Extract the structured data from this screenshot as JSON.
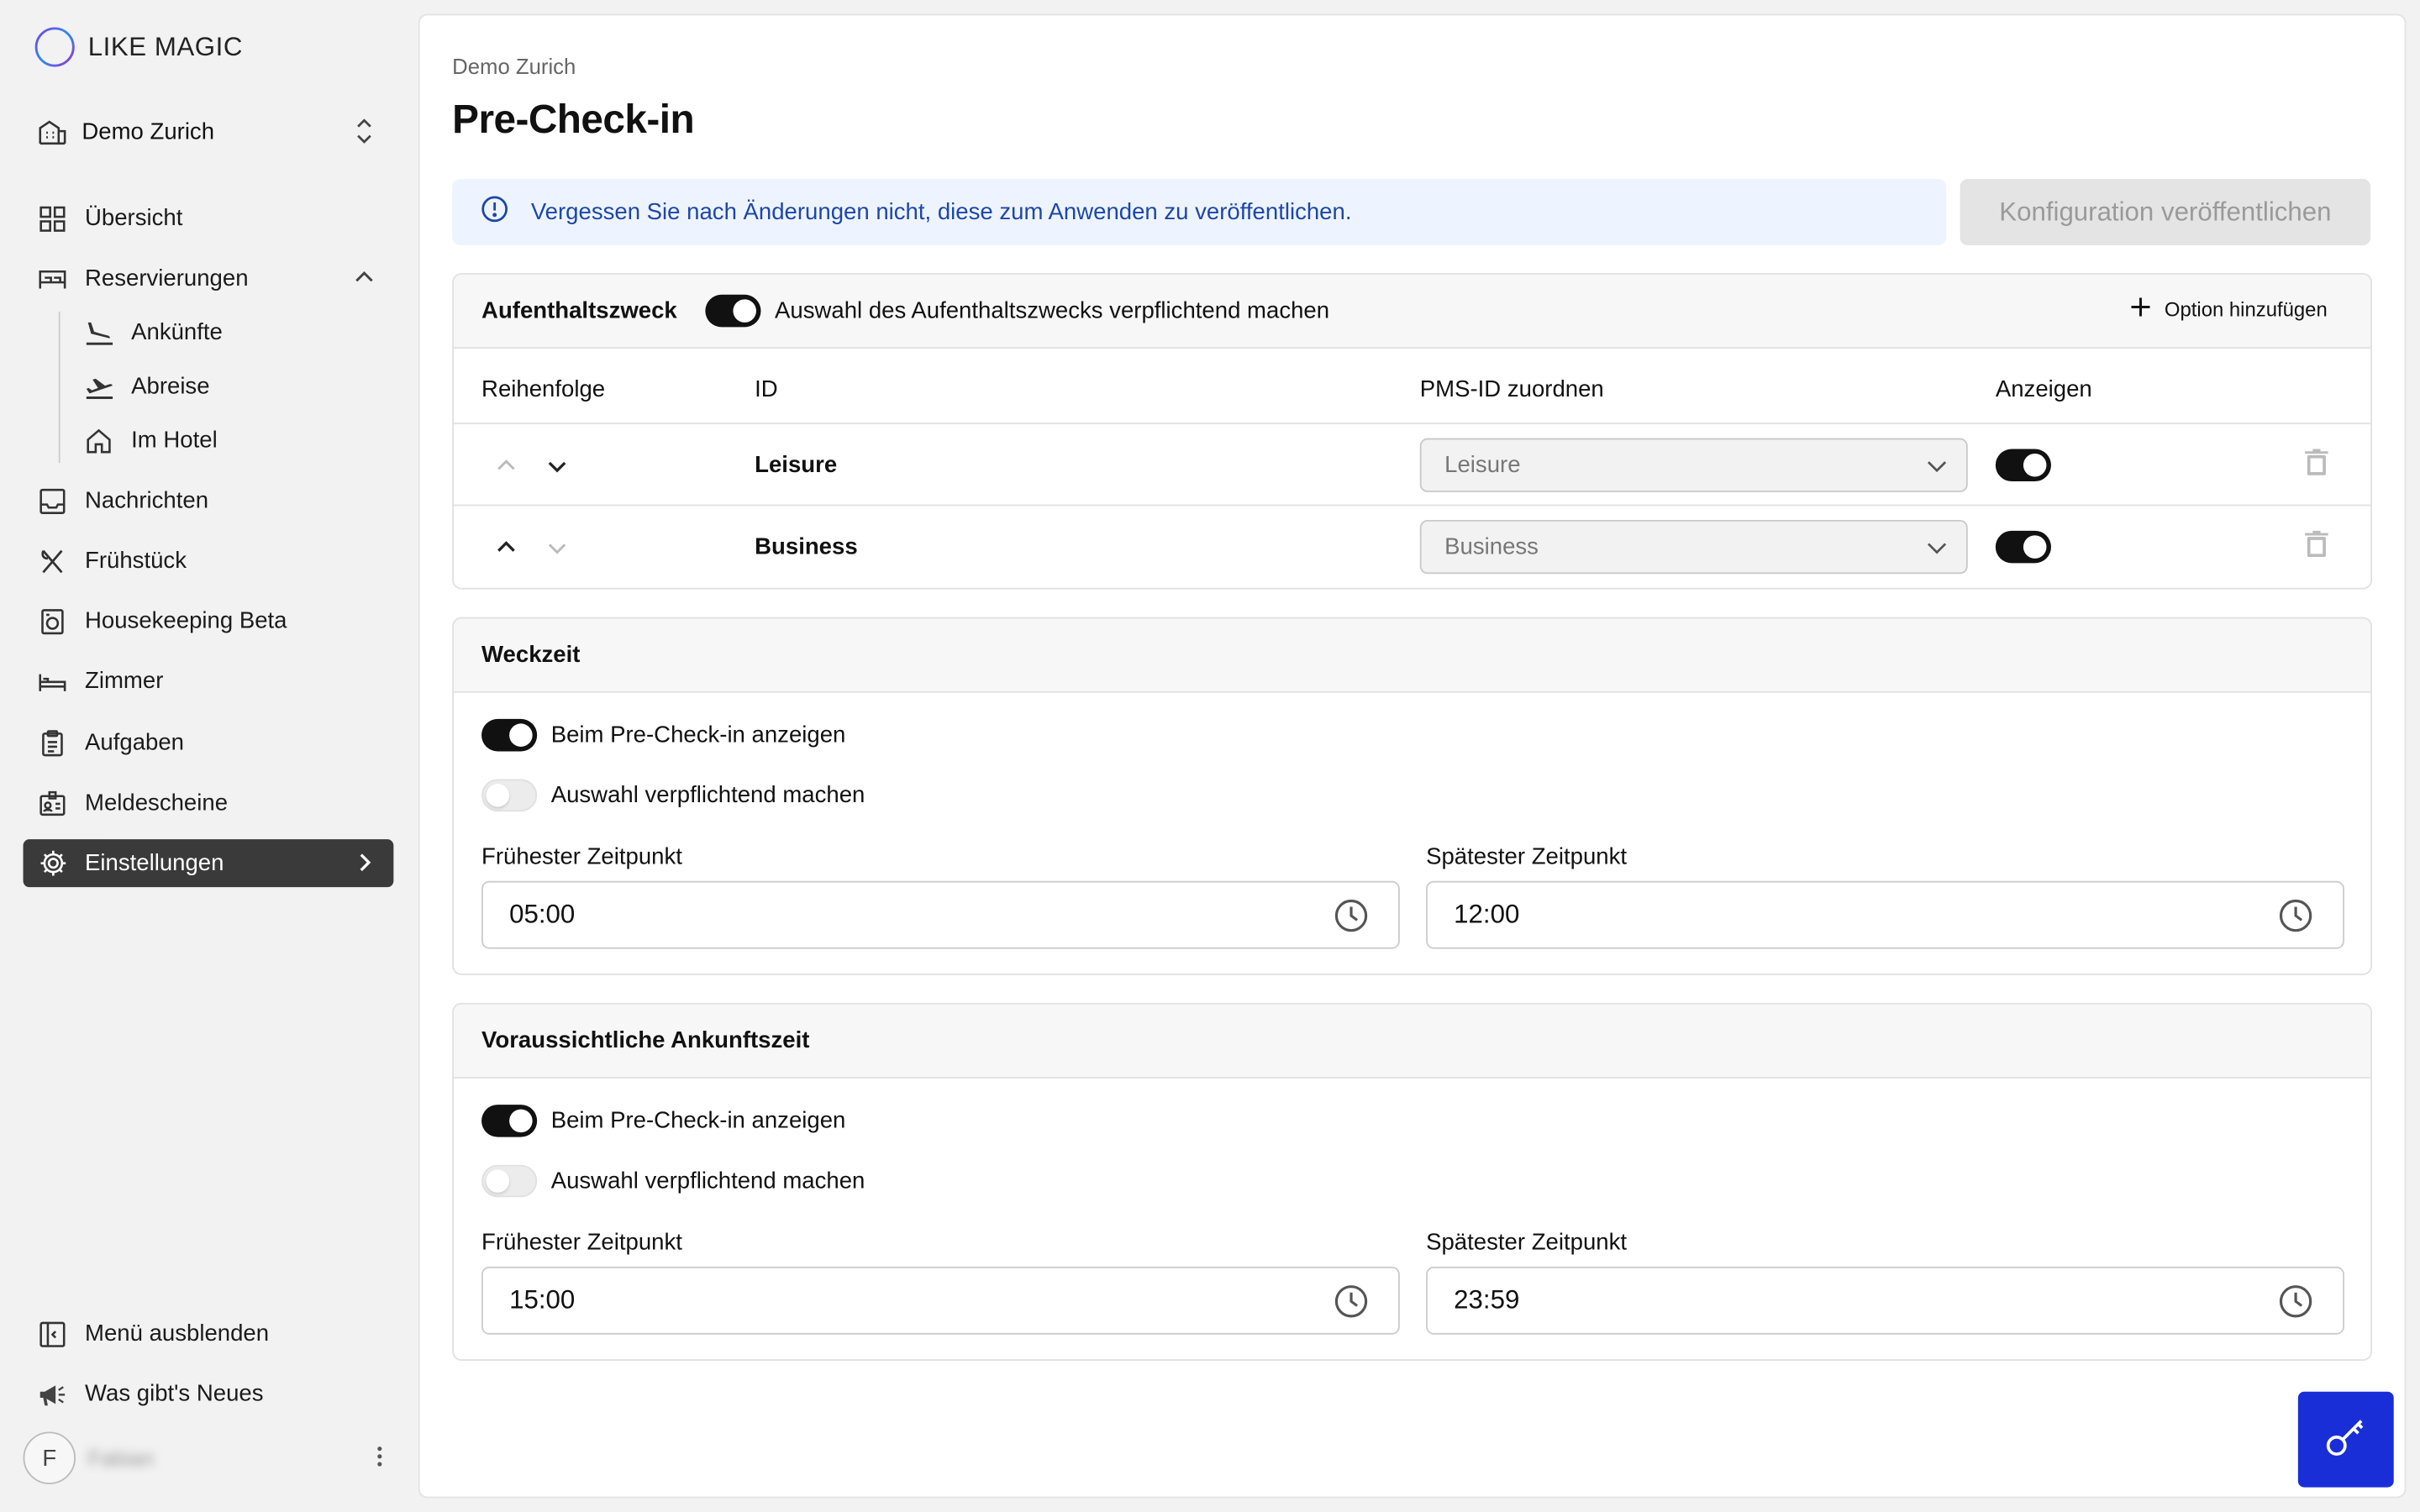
{
  "brand": {
    "name": "LIKE MAGIC"
  },
  "hotel_switch": {
    "label": "Demo Zurich"
  },
  "nav": {
    "overview": "Übersicht",
    "reservations": "Reservierungen",
    "arrivals": "Ankünfte",
    "departures": "Abreise",
    "in_hotel": "Im Hotel",
    "messages": "Nachrichten",
    "breakfast": "Frühstück",
    "housekeeping": "Housekeeping Beta",
    "rooms": "Zimmer",
    "tasks": "Aufgaben",
    "registration_forms": "Meldescheine",
    "settings": "Einstellungen",
    "hide_menu": "Menü ausblenden",
    "whats_new": "Was gibt's Neues"
  },
  "user": {
    "initial": "F",
    "name": "Fabian"
  },
  "page": {
    "breadcrumb": "Demo Zurich",
    "title": "Pre-Check-in",
    "notice": "Vergessen Sie nach Änderungen nicht, diese zum Anwenden zu veröffentlichen.",
    "publish_label": "Konfiguration veröffentlichen"
  },
  "purpose": {
    "title": "Aufenthaltszweck",
    "mandatory_label": "Auswahl des Aufenthaltszwecks verpflichtend machen",
    "mandatory_on": true,
    "add_option": "Option hinzufügen",
    "columns": [
      "Reihenfolge",
      "ID",
      "PMS-ID zuordnen",
      "Anzeigen"
    ],
    "rows": [
      {
        "id": "Leisure",
        "pms": "Leisure",
        "show": true
      },
      {
        "id": "Business",
        "pms": "Business",
        "show": true
      }
    ]
  },
  "wake": {
    "title": "Weckzeit",
    "show_label": "Beim Pre-Check-in anzeigen",
    "show_on": true,
    "mandatory_label": "Auswahl verpflichtend machen",
    "mandatory_on": false,
    "earliest_label": "Frühester Zeitpunkt",
    "earliest": "05:00",
    "latest_label": "Spätester Zeitpunkt",
    "latest": "12:00"
  },
  "arrival": {
    "title": "Voraussichtliche Ankunftszeit",
    "show_label": "Beim Pre-Check-in anzeigen",
    "show_on": true,
    "mandatory_label": "Auswahl verpflichtend machen",
    "mandatory_on": false,
    "earliest_label": "Frühester Zeitpunkt",
    "earliest": "15:00",
    "latest_label": "Spätester Zeitpunkt",
    "latest": "23:59"
  },
  "colors": {
    "accent": "#1a2ed8",
    "notice_bg": "#eef4ff",
    "notice_text": "#1d47a8",
    "active_nav": "#3a3a3a"
  },
  "icons": [
    "building-icon",
    "updown-icon",
    "grid-icon",
    "bed-icon",
    "plane-landing-icon",
    "plane-takeoff-icon",
    "home-icon",
    "inbox-icon",
    "cutlery-icon",
    "washer-icon",
    "bed-side-icon",
    "clipboard-icon",
    "id-card-icon",
    "gear-icon",
    "sidebar-collapse-icon",
    "megaphone-icon",
    "info-icon",
    "plus-icon",
    "chevron-up-icon",
    "chevron-down-icon",
    "trash-icon",
    "clock-icon",
    "key-icon",
    "kebab-icon"
  ]
}
